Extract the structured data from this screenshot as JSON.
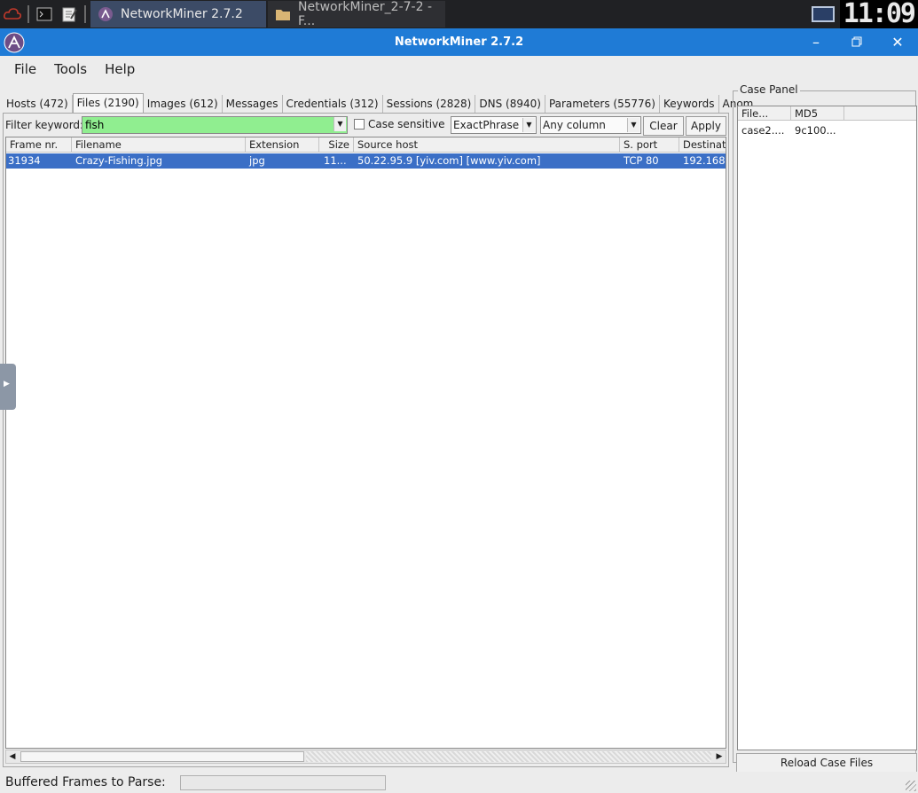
{
  "taskbar": {
    "tasks": [
      {
        "label": "NetworkMiner 2.7.2",
        "icon": "networkminer-icon"
      },
      {
        "label": "NetworkMiner_2-7-2 - F...",
        "icon": "folder-icon"
      }
    ],
    "clock": "11:09"
  },
  "window": {
    "title": "NetworkMiner 2.7.2"
  },
  "menu": {
    "items": [
      "File",
      "Tools",
      "Help"
    ]
  },
  "tabs": [
    "Hosts (472)",
    "Files (2190)",
    "Images (612)",
    "Messages",
    "Credentials (312)",
    "Sessions (2828)",
    "DNS (8940)",
    "Parameters (55776)",
    "Keywords",
    "Anom"
  ],
  "selected_tab": "Files (2190)",
  "filter": {
    "label": "Filter keyword:",
    "value": "fish",
    "case_sensitive_label": "Case sensitive",
    "match_mode": "ExactPhrase",
    "column_scope": "Any column",
    "clear_label": "Clear",
    "apply_label": "Apply"
  },
  "files_table": {
    "columns": [
      "Frame nr.",
      "Filename",
      "Extension",
      "Size",
      "Source host",
      "S. port",
      "Destinat"
    ],
    "rows": [
      [
        "31934",
        "Crazy-Fishing.jpg",
        "jpg",
        "11...",
        "50.22.95.9 [yiv.com] [www.yiv.com]",
        "TCP 80",
        "192.168"
      ]
    ]
  },
  "case_panel": {
    "title": "Case Panel",
    "columns": [
      "File...",
      "MD5"
    ],
    "rows": [
      [
        "case2....",
        "9c100..."
      ]
    ],
    "reload_label": "Reload Case Files"
  },
  "status": {
    "label": "Buffered Frames to Parse:"
  },
  "colors": {
    "titlebar": "#1f7bd6",
    "filter_match_bg": "#90ee90",
    "row_selected": "#3b6fc6",
    "taskbar": "#202124"
  }
}
